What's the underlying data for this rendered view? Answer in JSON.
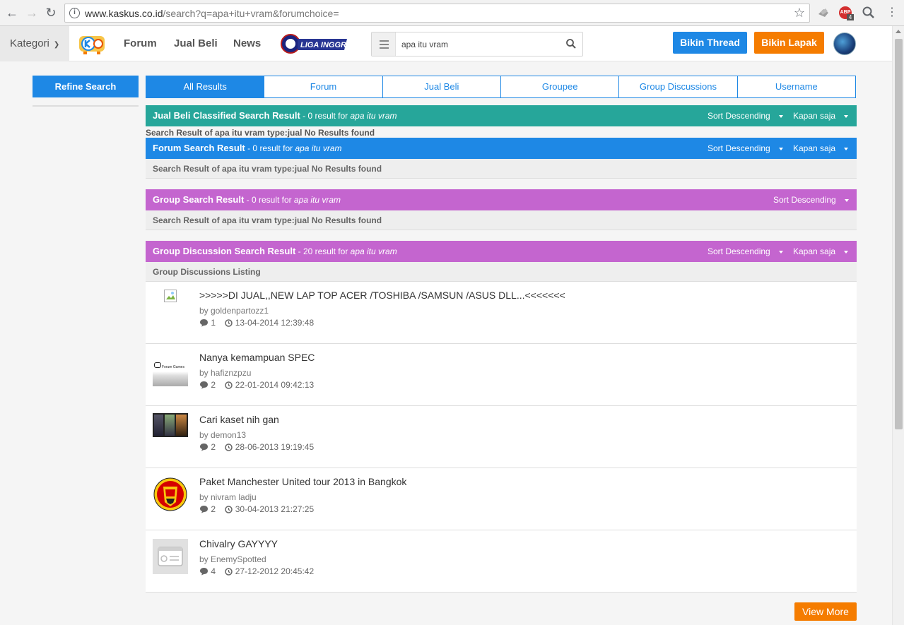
{
  "browser": {
    "url_host": "www.kaskus.co.id",
    "url_rest": "/search?q=apa+itu+vram&forumchoice=",
    "abp_badge": "ABP",
    "abp_count": "4"
  },
  "header": {
    "kategori": "Kategori",
    "nav": [
      "Forum",
      "Jual Beli",
      "News"
    ],
    "liga_logo_text": "LIGA INGGRIS",
    "search_value": "apa itu vram",
    "bikin_thread": "Bikin Thread",
    "bikin_lapak": "Bikin Lapak"
  },
  "sidebar": {
    "refine": "Refine Search"
  },
  "tabs": [
    "All Results",
    "Forum",
    "Jual Beli",
    "Groupee",
    "Group Discussions",
    "Username"
  ],
  "sections": {
    "jualbeli": {
      "title": "Jual Beli Classified Search Result",
      "count": " - 0 result for ",
      "query": "apa itu vram",
      "sort": "Sort Descending",
      "time": "Kapan saja",
      "message": "Search Result of apa itu vram type:jual No Results found"
    },
    "forum": {
      "title": "Forum Search Result",
      "count": " - 0 result for ",
      "query": "apa itu vram",
      "sort": "Sort Descending",
      "time": "Kapan saja",
      "message": "Search Result of apa itu vram type:jual No Results found"
    },
    "group": {
      "title": "Group Search Result",
      "count": " - 0 result for ",
      "query": "apa itu vram",
      "sort": "Sort Descending",
      "message": "Search Result of apa itu vram type:jual No Results found"
    },
    "discussion": {
      "title": "Group Discussion Search Result",
      "count": " - 20 result for ",
      "query": "apa itu vram",
      "sort": "Sort Descending",
      "time": "Kapan saja",
      "listing": "Group Discussions Listing"
    }
  },
  "discussions": [
    {
      "title": ">>>>>DI JUAL,,NEW LAP TOP ACER /TOSHIBA /SAMSUN /ASUS DLL...<<<<<<<",
      "by": "by goldenpartozz1",
      "comments": "1",
      "date": "13-04-2014 12:39:48"
    },
    {
      "title": "Nanya kemampuan SPEC",
      "by": "by hafiznzpzu",
      "comments": "2",
      "date": "22-01-2014 09:42:13"
    },
    {
      "title": "Cari kaset nih gan",
      "by": "by demon13",
      "comments": "2",
      "date": "28-06-2013 19:19:45"
    },
    {
      "title": "Paket Manchester United tour 2013 in Bangkok",
      "by": "by nivram ladju",
      "comments": "2",
      "date": "30-04-2013 21:27:25"
    },
    {
      "title": "Chivalry GAYYYY",
      "by": "by EnemySpotted",
      "comments": "4",
      "date": "27-12-2012 20:45:42"
    }
  ],
  "thumb2_text": "Forum Games",
  "view_more": "View More",
  "colors": {
    "blue": "#1e88e5",
    "teal": "#26a69a",
    "purple": "#c465cf",
    "orange": "#f57c00"
  }
}
